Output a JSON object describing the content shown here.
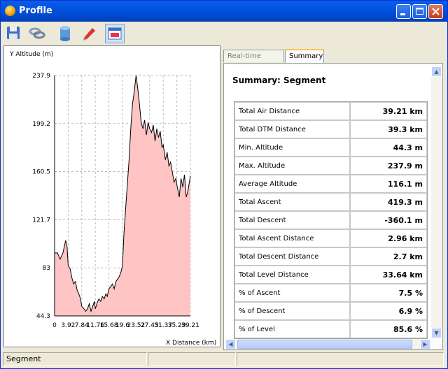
{
  "window": {
    "title": "Profile",
    "title_buttons": [
      "minimize",
      "maximize",
      "close"
    ]
  },
  "toolbar": {
    "tools": [
      {
        "name": "save-icon"
      },
      {
        "name": "link-icon"
      },
      {
        "name": "database-icon"
      },
      {
        "name": "pen-icon"
      },
      {
        "name": "window-icon",
        "active": true
      }
    ]
  },
  "chart": {
    "y_axis_label": "Y Altitude (m)",
    "x_axis_label": "X Distance (km)"
  },
  "chart_data": {
    "type": "area",
    "y_ticks": [
      "237.9",
      "199.2",
      "160.5",
      "121.7",
      "83",
      "44.3"
    ],
    "x_ticks": [
      "0",
      "3.92",
      "7.84",
      "11.76",
      "15.68",
      "19.6",
      "23.52",
      "27.45",
      "31.37",
      "35.29",
      "39.21"
    ],
    "ylim": [
      44.3,
      237.9
    ],
    "xlim": [
      0,
      39.21
    ],
    "grid": true,
    "fill_color": "#ffc4c4",
    "line_color": "#000000",
    "x": [
      0,
      0.8,
      1.6,
      2.4,
      3.2,
      3.6,
      3.92,
      4.5,
      5.0,
      5.5,
      6.0,
      6.5,
      7.0,
      7.5,
      7.84,
      8.5,
      9.0,
      9.5,
      10.0,
      10.5,
      11.0,
      11.5,
      11.76,
      12.3,
      12.8,
      13.3,
      13.8,
      14.3,
      14.8,
      15.2,
      15.68,
      16.2,
      16.7,
      17.2,
      17.7,
      18.2,
      18.7,
      19.2,
      19.6,
      20.0,
      20.5,
      21.0,
      21.5,
      22.0,
      22.5,
      23.0,
      23.52,
      24.0,
      24.5,
      25.0,
      25.5,
      26.0,
      26.5,
      27.0,
      27.45,
      28.0,
      28.5,
      29.0,
      29.5,
      30.0,
      30.5,
      31.0,
      31.37,
      32.0,
      32.5,
      33.0,
      33.5,
      34.0,
      34.5,
      35.0,
      35.29,
      36.0,
      36.5,
      37.0,
      37.5,
      38.0,
      38.5,
      39.21
    ],
    "y": [
      95,
      95,
      90,
      95,
      105,
      100,
      85,
      82,
      75,
      70,
      72,
      65,
      62,
      58,
      52,
      50,
      48,
      50,
      54,
      48,
      52,
      56,
      50,
      55,
      58,
      56,
      60,
      58,
      62,
      60,
      66,
      68,
      70,
      66,
      72,
      74,
      76,
      80,
      85,
      110,
      130,
      150,
      170,
      195,
      215,
      225,
      237.9,
      228,
      215,
      200,
      195,
      202,
      190,
      200,
      195,
      192,
      198,
      185,
      195,
      188,
      193,
      180,
      182,
      170,
      176,
      165,
      168,
      160,
      152,
      155,
      150,
      140,
      155,
      148,
      158,
      140,
      145,
      157
    ]
  },
  "tabs": [
    {
      "label": "Real-time Profile",
      "active": false
    },
    {
      "label": "Summary",
      "active": true
    }
  ],
  "summary": {
    "title": "Summary: Segment",
    "rows": [
      {
        "label": "Total Air Distance",
        "value": "39.21 km"
      },
      {
        "label": "Total DTM Distance",
        "value": "39.3 km"
      },
      {
        "label": "Min. Altitude",
        "value": "44.3 m"
      },
      {
        "label": "Max. Altitude",
        "value": "237.9 m"
      },
      {
        "label": "Average Altitude",
        "value": "116.1 m"
      },
      {
        "label": "Total Ascent",
        "value": "419.3 m"
      },
      {
        "label": "Total Descent",
        "value": "-360.1 m"
      },
      {
        "label": "Total Ascent Distance",
        "value": "2.96 km"
      },
      {
        "label": "Total Descent Distance",
        "value": "2.7 km"
      },
      {
        "label": "Total Level Distance",
        "value": "33.64 km"
      },
      {
        "label": "% of Ascent",
        "value": "7.5 %"
      },
      {
        "label": "% of Descent",
        "value": "6.9 %"
      },
      {
        "label": "% of Level",
        "value": "85.6 %"
      }
    ]
  },
  "status": {
    "text": "Segment"
  }
}
